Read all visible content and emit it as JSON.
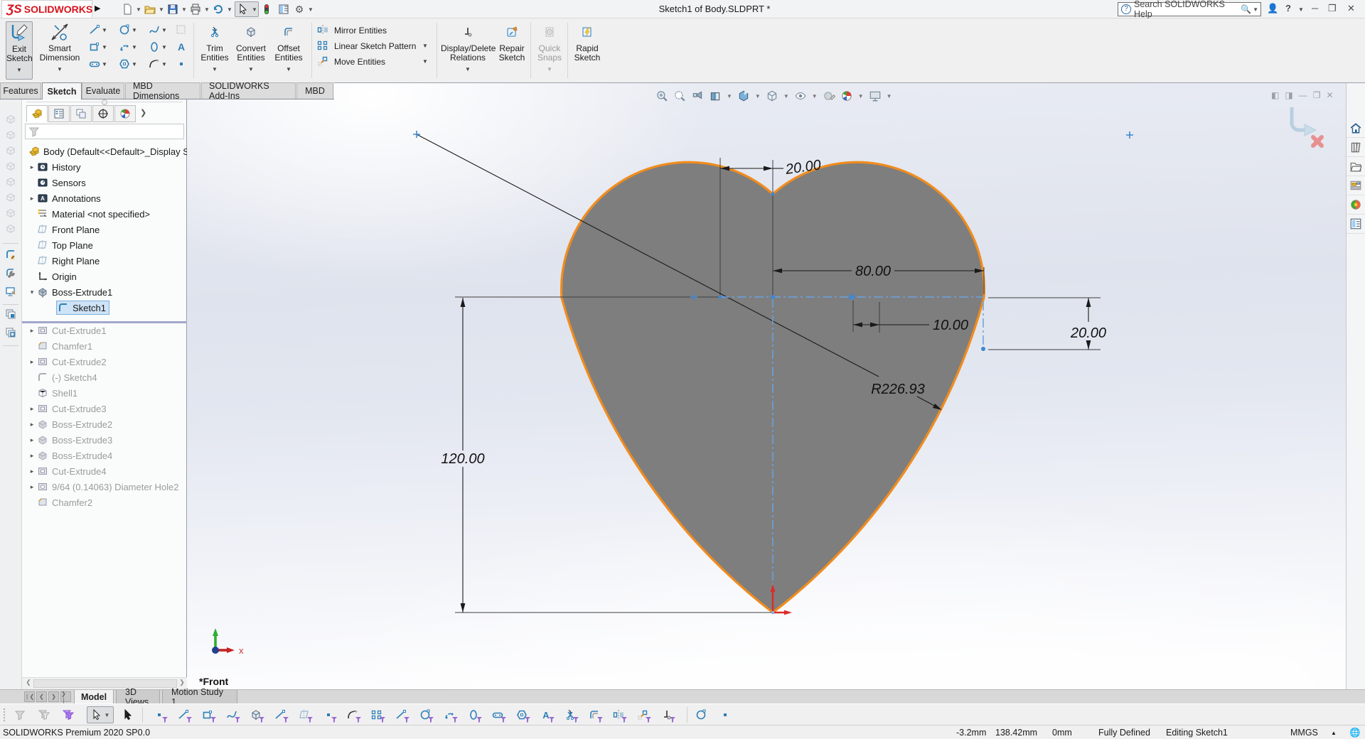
{
  "colors": {
    "accent_orange": "#f08c1e",
    "heart_gray": "#7e7e7e",
    "logo_red": "#d6121c",
    "centerline_blue": "#6aa2e0"
  },
  "title_bar": {
    "logo_text": "SOLIDWORKS",
    "title": "Sketch1 of Body.SLDPRT *",
    "search_placeholder": "Search SOLIDWORKS Help"
  },
  "ribbon": {
    "exit_sketch": {
      "l1": "Exit",
      "l2": "Sketch"
    },
    "smart_dimension": {
      "l1": "Smart",
      "l2": "Dimension"
    },
    "trim": {
      "l1": "Trim",
      "l2": "Entities"
    },
    "convert": {
      "l1": "Convert",
      "l2": "Entities"
    },
    "offset": {
      "l1": "Offset",
      "l2": "Entities"
    },
    "mirror": "Mirror Entities",
    "linear_pattern": "Linear Sketch Pattern",
    "move": "Move Entities",
    "display_delete": {
      "l1": "Display/Delete",
      "l2": "Relations"
    },
    "repair": {
      "l1": "Repair",
      "l2": "Sketch"
    },
    "quick_snaps": {
      "l1": "Quick",
      "l2": "Snaps"
    },
    "rapid": {
      "l1": "Rapid",
      "l2": "Sketch"
    }
  },
  "command_tabs": {
    "items": [
      "Features",
      "Sketch",
      "Evaluate",
      "MBD Dimensions",
      "SOLIDWORKS Add-Ins",
      "MBD"
    ],
    "active": "Sketch"
  },
  "feature_tree": {
    "root": "Body  (Default<<Default>_Display Sta",
    "items": [
      {
        "label": "History",
        "icon": "folder-history",
        "arrow": true
      },
      {
        "label": "Sensors",
        "icon": "folder-sensors"
      },
      {
        "label": "Annotations",
        "icon": "folder-annotations",
        "arrow": true
      },
      {
        "label": "Material <not specified>",
        "icon": "material"
      },
      {
        "label": "Front Plane",
        "icon": "plane"
      },
      {
        "label": "Top Plane",
        "icon": "plane"
      },
      {
        "label": "Right Plane",
        "icon": "plane"
      },
      {
        "label": "Origin",
        "icon": "origin"
      },
      {
        "label": "Boss-Extrude1",
        "icon": "boss",
        "arrow": "open"
      },
      {
        "label": "Sketch1",
        "icon": "sketch",
        "selected": true,
        "child": true
      },
      {
        "rollback": true
      },
      {
        "label": "Cut-Extrude1",
        "icon": "cut",
        "arrow": true,
        "grayed": true
      },
      {
        "label": "Chamfer1",
        "icon": "chamfer",
        "grayed": true
      },
      {
        "label": "Cut-Extrude2",
        "icon": "cut",
        "arrow": true,
        "grayed": true
      },
      {
        "label": "(-) Sketch4",
        "icon": "sketch-gray",
        "grayed": true
      },
      {
        "label": "Shell1",
        "icon": "shell",
        "grayed": true
      },
      {
        "label": "Cut-Extrude3",
        "icon": "cut",
        "arrow": true,
        "grayed": true
      },
      {
        "label": "Boss-Extrude2",
        "icon": "boss-gray",
        "arrow": true,
        "grayed": true
      },
      {
        "label": "Boss-Extrude3",
        "icon": "boss-gray",
        "arrow": true,
        "grayed": true
      },
      {
        "label": "Boss-Extrude4",
        "icon": "boss-gray",
        "arrow": true,
        "grayed": true
      },
      {
        "label": "Cut-Extrude4",
        "icon": "cut",
        "arrow": true,
        "grayed": true
      },
      {
        "label": "9/64 (0.14063) Diameter Hole2",
        "icon": "hole",
        "arrow": true,
        "grayed": true
      },
      {
        "label": "Chamfer2",
        "icon": "chamfer",
        "grayed": true
      }
    ]
  },
  "sketch": {
    "dim_top": "20.00",
    "dim_width": "80.00",
    "dim_offset": "10.00",
    "dim_right": "20.00",
    "dim_height": "120.00",
    "dim_radius": "R226.93",
    "view_label": "*Front",
    "axis_x_label": "x"
  },
  "bottom_tabs": {
    "items": [
      "Model",
      "3D Views",
      "Motion Study 1"
    ],
    "active": "Model"
  },
  "status_bar": {
    "product": "SOLIDWORKS Premium 2020 SP0.0",
    "x": "-3.2mm",
    "y": "138.42mm",
    "z": "0mm",
    "state": "Fully Defined",
    "mode": "Editing Sketch1",
    "units": "MMGS"
  }
}
